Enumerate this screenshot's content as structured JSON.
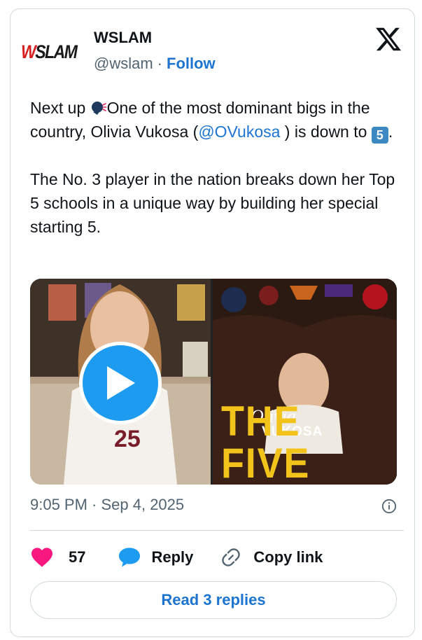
{
  "account": {
    "logo_text_a": "W",
    "logo_text_b": "SLAM",
    "name": "WSLAM",
    "handle": "@wslam",
    "separator": "·",
    "follow_label": "Follow"
  },
  "tweet": {
    "line1_pre": "Next up ",
    "line1_post": "One of the most dominant bigs in the country, Olivia Vukosa (",
    "mention": "@OVukosa",
    "line1_end": " ) is down to ",
    "emoji_five": "5",
    "line1_period": ".",
    "paragraph2": "The No. 3 player in the nation breaks down her Top 5 schools in a unique way by building her special starting 5."
  },
  "media": {
    "name_script": "Olivia",
    "surname": "VUKOSA",
    "title": "THE FIVE",
    "jersey": "25"
  },
  "timestamp": "9:05 PM · Sep 4, 2025",
  "actions": {
    "likes_count": "57",
    "reply_label": "Reply",
    "copy_label": "Copy link"
  },
  "read_replies_label": "Read 3 replies",
  "colors": {
    "accent": "#1d75d1",
    "like": "#f91880",
    "reply_icon": "#1d9bf0",
    "text": "#0f1419",
    "muted": "#536471"
  }
}
